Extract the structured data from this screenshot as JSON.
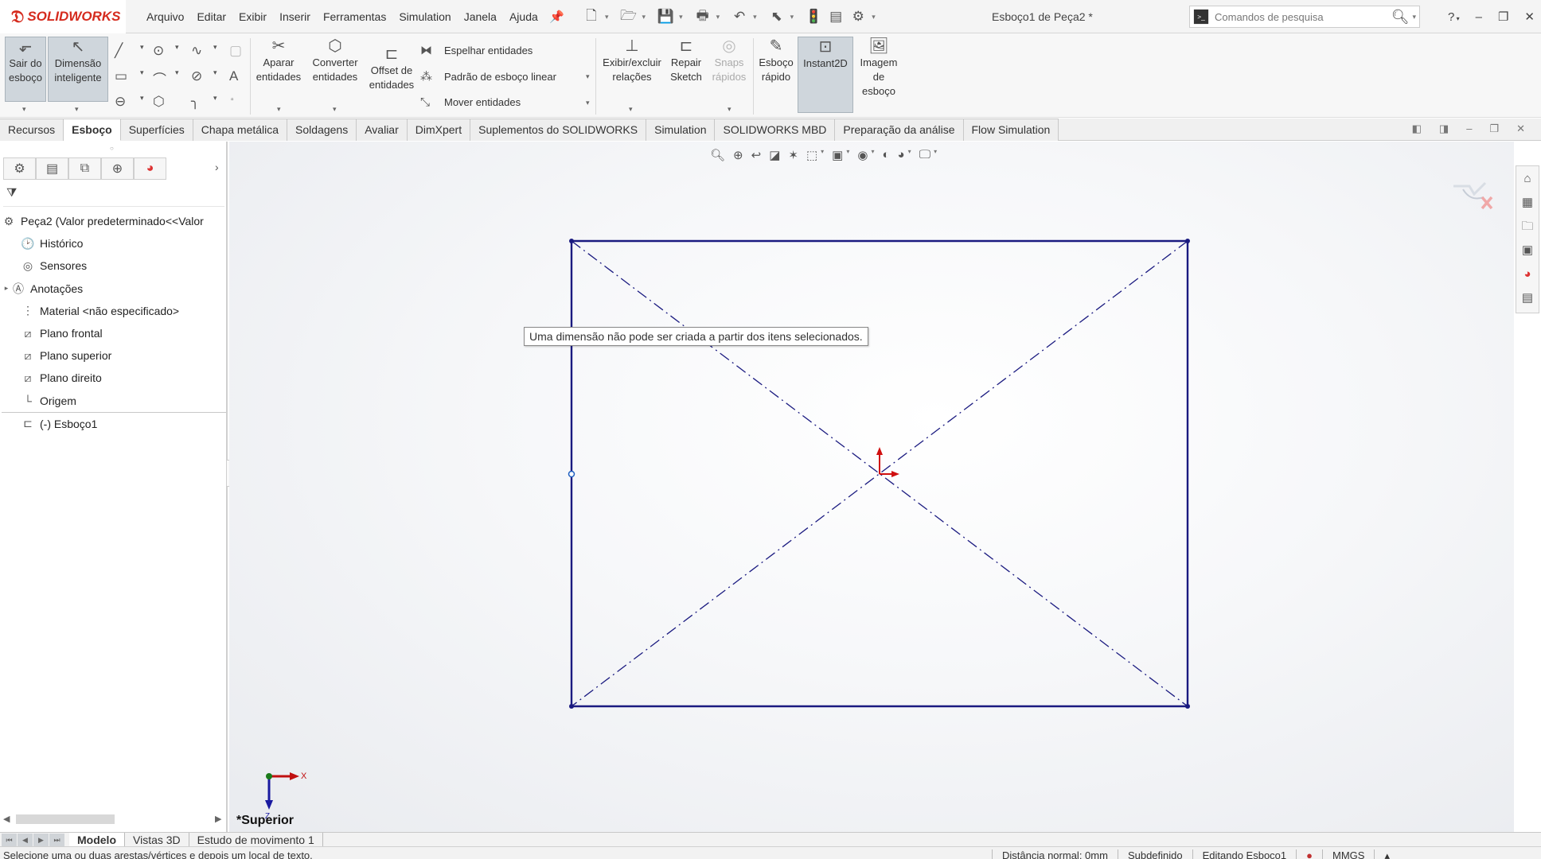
{
  "app": {
    "brand": "SOLIDWORKS",
    "document_title": "Esboço1 de Peça2 *"
  },
  "menu": [
    "Arquivo",
    "Editar",
    "Exibir",
    "Inserir",
    "Ferramentas",
    "Simulation",
    "Janela",
    "Ajuda"
  ],
  "search": {
    "placeholder": "Comandos de pesquisa"
  },
  "ribbon": {
    "exit_sketch": "Sair do esboço",
    "smart_dimension": "Dimensão inteligente",
    "trim": "Aparar entidades",
    "convert": "Converter entidades",
    "offset": "Offset de entidades",
    "mirror": "Espelhar entidades",
    "linear_pattern": "Padrão de esboço linear",
    "move": "Mover entidades",
    "relations": "Exibir/excluir relações",
    "repair": "Repair Sketch",
    "snaps": "Snaps rápidos",
    "quick_sketch": "Esboço rápido",
    "instant2d": "Instant2D",
    "sketch_picture": "Imagem de esboço"
  },
  "tabs": [
    {
      "label": "Recursos",
      "active": false
    },
    {
      "label": "Esboço",
      "active": true
    },
    {
      "label": "Superfícies",
      "active": false
    },
    {
      "label": "Chapa metálica",
      "active": false
    },
    {
      "label": "Soldagens",
      "active": false
    },
    {
      "label": "Avaliar",
      "active": false
    },
    {
      "label": "DimXpert",
      "active": false
    },
    {
      "label": "Suplementos do SOLIDWORKS",
      "active": false
    },
    {
      "label": "Simulation",
      "active": false
    },
    {
      "label": "SOLIDWORKS MBD",
      "active": false
    },
    {
      "label": "Preparação da análise",
      "active": false
    },
    {
      "label": "Flow Simulation",
      "active": false
    }
  ],
  "tree": {
    "root": "Peça2  (Valor predeterminado<<Valor",
    "items": [
      {
        "label": "Histórico",
        "icon": "history-icon"
      },
      {
        "label": "Sensores",
        "icon": "sensor-icon"
      },
      {
        "label": "Anotações",
        "icon": "annotation-icon",
        "expandable": true
      },
      {
        "label": "Material <não especificado>",
        "icon": "material-icon"
      },
      {
        "label": "Plano frontal",
        "icon": "plane-icon"
      },
      {
        "label": "Plano superior",
        "icon": "plane-icon"
      },
      {
        "label": "Plano direito",
        "icon": "plane-icon"
      },
      {
        "label": "Origem",
        "icon": "origin-icon"
      }
    ],
    "sketch": "(-) Esboço1"
  },
  "viewport": {
    "tooltip": "Uma dimensão não pode ser criada a partir dos itens selecionados.",
    "view_name": "*Superior",
    "triad_x": "X",
    "triad_z": "Z"
  },
  "bottom_tabs": [
    {
      "label": "Modelo",
      "active": true
    },
    {
      "label": "Vistas 3D",
      "active": false
    },
    {
      "label": "Estudo de movimento 1",
      "active": false
    }
  ],
  "status": {
    "message": "Selecione uma ou duas arestas/vértices e depois um local de texto.",
    "distance": "Distância normal: 0mm",
    "definition": "Subdefinido",
    "editing": "Editando Esboço1",
    "units": "MMGS"
  },
  "colors": {
    "sketch_line": "#1a1a80",
    "origin_red": "#d01010",
    "brand_red": "#d52b1e"
  }
}
